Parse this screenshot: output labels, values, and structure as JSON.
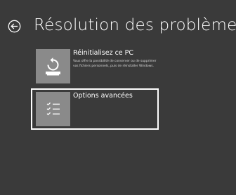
{
  "page": {
    "title": "Résolution des problèmes"
  },
  "options": [
    {
      "title": "Réinitialisez ce PC",
      "description": "Vous offre la possibilité de conserver ou de supprimer vos fichiers personnels, puis de réinstaller Windows.",
      "icon": "reset-pc-icon",
      "selected": false
    },
    {
      "title": "Options avancées",
      "description": "",
      "icon": "checklist-icon",
      "selected": true
    }
  ],
  "colors": {
    "background": "#3a3a3a",
    "tile_icon_bg": "#8a8a8a",
    "text": "#ffffff",
    "focus_border": "#ffffff"
  }
}
